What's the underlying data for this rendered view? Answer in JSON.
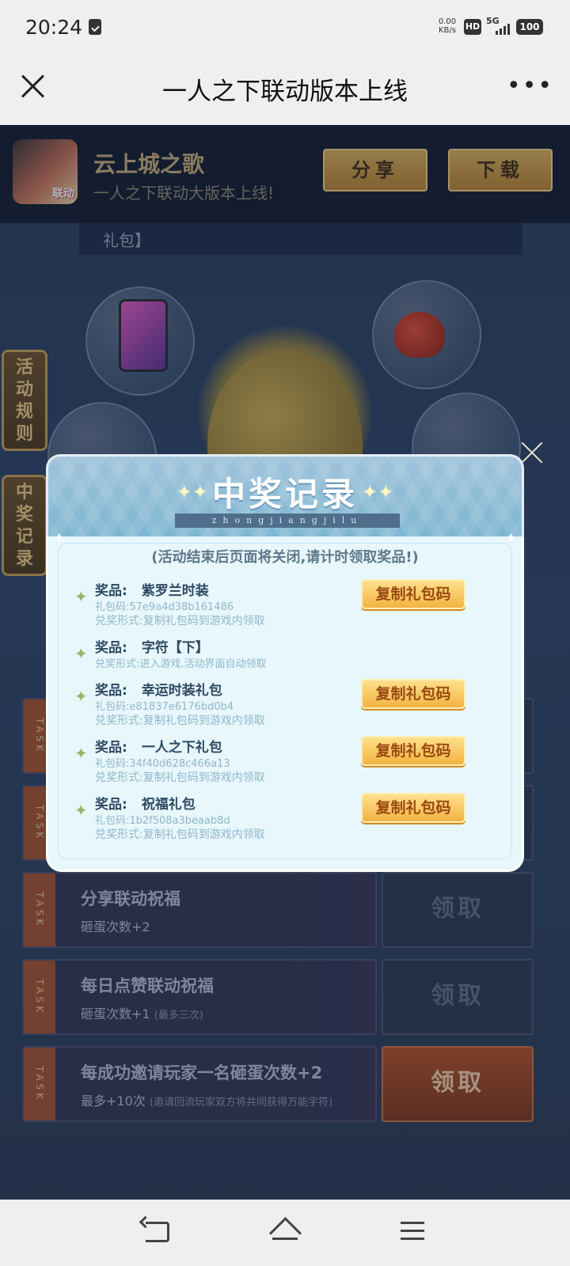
{
  "status_bar": {
    "time": "20:24",
    "net_speed_value": "0.00",
    "net_speed_unit": "KB/s",
    "hd_label": "HD",
    "network_label": "5G",
    "battery": "100"
  },
  "header": {
    "title": "一人之下联动版本上线",
    "close_icon": "close-icon",
    "more_icon": "more-dots-icon"
  },
  "app_banner": {
    "name": "云上城之歌",
    "subtitle": "一人之下联动大版本上线!",
    "icon_tag": "联动",
    "share_label": "分享",
    "download_label": "下载"
  },
  "background": {
    "tab_label": "礼包】",
    "rules_tab": "活动规则",
    "records_tab": "中奖记录",
    "tasks": [
      {
        "strip": "TASK",
        "title": "分享联动祝福",
        "sub": "砸蛋次数+2",
        "note": "",
        "button": "领取",
        "active": false
      },
      {
        "strip": "TASK",
        "title": "每日点赞联动祝福",
        "sub": "砸蛋次数+1",
        "note": "(最多三次)",
        "button": "领取",
        "active": false
      },
      {
        "strip": "TASK",
        "title": "每成功邀请玩家一名砸蛋次数+2",
        "sub": "最多+10次",
        "note": "(邀请回流玩家双方将共同获得万能字符)",
        "button": "领取",
        "active": true
      }
    ]
  },
  "modal": {
    "title": "中奖记录",
    "pinyin": "zhongjiangjilu",
    "notice": "(活动结束后页面将关闭,请计时领取奖品!)",
    "prize_label": "奖品:",
    "code_label": "礼包码:",
    "method_label": "兑奖形式:",
    "copy_label": "复制礼包码",
    "prizes": [
      {
        "name": "紫罗兰时装",
        "code": "57e9a4d38b161486",
        "method": "复制礼包码到游戏内领取"
      },
      {
        "name": "字符【下】",
        "code": "",
        "method": "进入游戏,活动界面自动领取"
      },
      {
        "name": "幸运时装礼包",
        "code": "e81837e6176bd0b4",
        "method": "复制礼包码到游戏内领取"
      },
      {
        "name": "一人之下礼包",
        "code": "34f40d628c466a13",
        "method": "复制礼包码到游戏内领取"
      },
      {
        "name": "祝福礼包",
        "code": "1b2f508a3beaab8d",
        "method": "复制礼包码到游戏内领取"
      }
    ]
  },
  "colors": {
    "modal_header": "#7fb7d2",
    "copy_button": "#f2b342",
    "gold_button": "#d9a74f",
    "active_claim": "#b14a1c"
  }
}
